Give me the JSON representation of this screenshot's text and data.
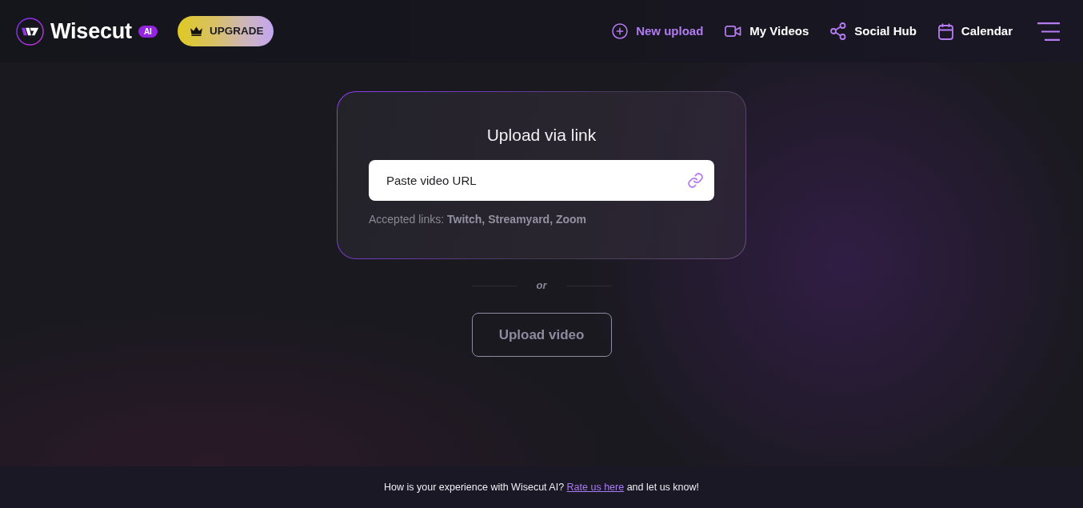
{
  "header": {
    "logo_text": "Wisecut",
    "logo_badge": "AI",
    "upgrade_button": "UPGRADE",
    "nav": [
      {
        "kind": "upload",
        "label": "New upload",
        "selected": true
      },
      {
        "kind": "videos",
        "label": "My Videos",
        "selected": false
      },
      {
        "kind": "share",
        "label": "Social Hub",
        "selected": false
      },
      {
        "kind": "calendar",
        "label": "Calendar",
        "selected": false
      }
    ]
  },
  "upload_card": {
    "title": "Upload via link",
    "url_field": {
      "placeholder": "Paste video URL"
    },
    "accepted_links": "Accepted links: **Twitch, Streamyard, Zoom**"
  },
  "divider_text": "or",
  "upload_button": "Upload video",
  "footer": {
    "message_start": "How is your experience with Wisecut AI?",
    "link": "Rate us here",
    "message_end": "and let us know!"
  }
}
